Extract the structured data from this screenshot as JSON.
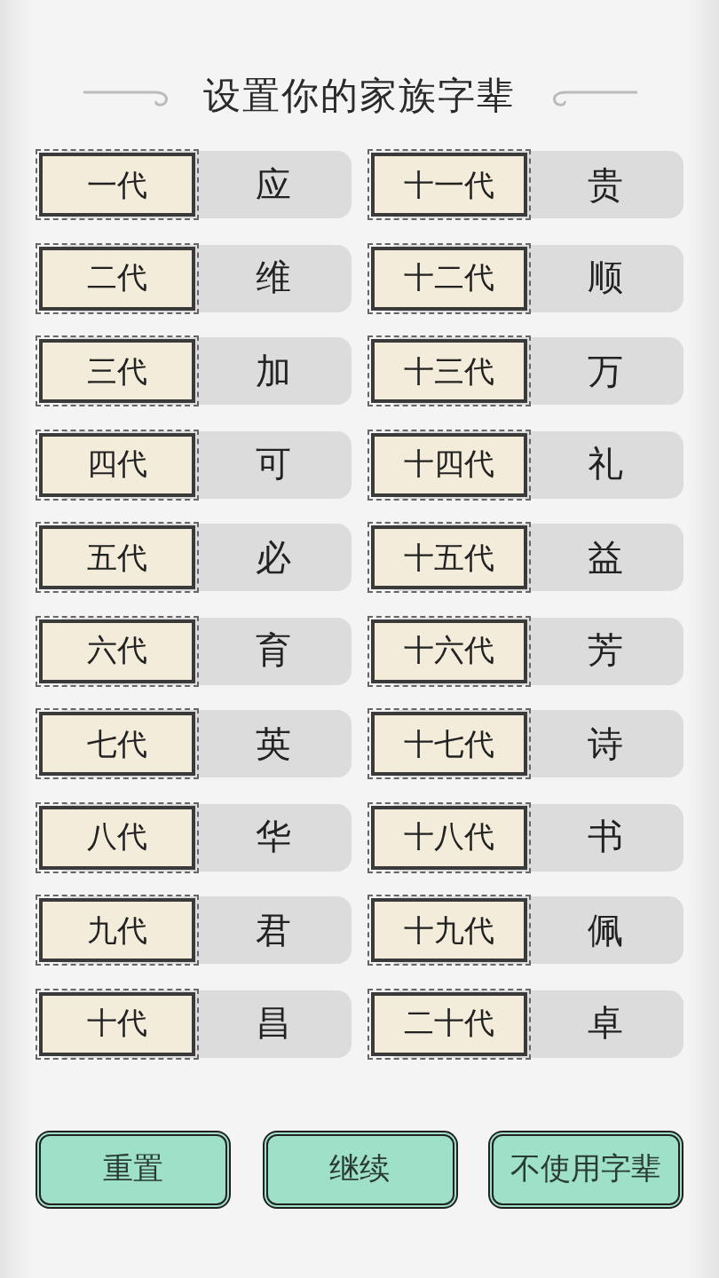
{
  "title": "设置你的家族字辈",
  "generations": [
    {
      "label": "一代",
      "character": "应"
    },
    {
      "label": "十一代",
      "character": "贵"
    },
    {
      "label": "二代",
      "character": "维"
    },
    {
      "label": "十二代",
      "character": "顺"
    },
    {
      "label": "三代",
      "character": "加"
    },
    {
      "label": "十三代",
      "character": "万"
    },
    {
      "label": "四代",
      "character": "可"
    },
    {
      "label": "十四代",
      "character": "礼"
    },
    {
      "label": "五代",
      "character": "必"
    },
    {
      "label": "十五代",
      "character": "益"
    },
    {
      "label": "六代",
      "character": "育"
    },
    {
      "label": "十六代",
      "character": "芳"
    },
    {
      "label": "七代",
      "character": "英"
    },
    {
      "label": "十七代",
      "character": "诗"
    },
    {
      "label": "八代",
      "character": "华"
    },
    {
      "label": "十八代",
      "character": "书"
    },
    {
      "label": "九代",
      "character": "君"
    },
    {
      "label": "十九代",
      "character": "佩"
    },
    {
      "label": "十代",
      "character": "昌"
    },
    {
      "label": "二十代",
      "character": "卓"
    }
  ],
  "buttons": [
    "重置",
    "继续",
    "不使用字辈"
  ]
}
